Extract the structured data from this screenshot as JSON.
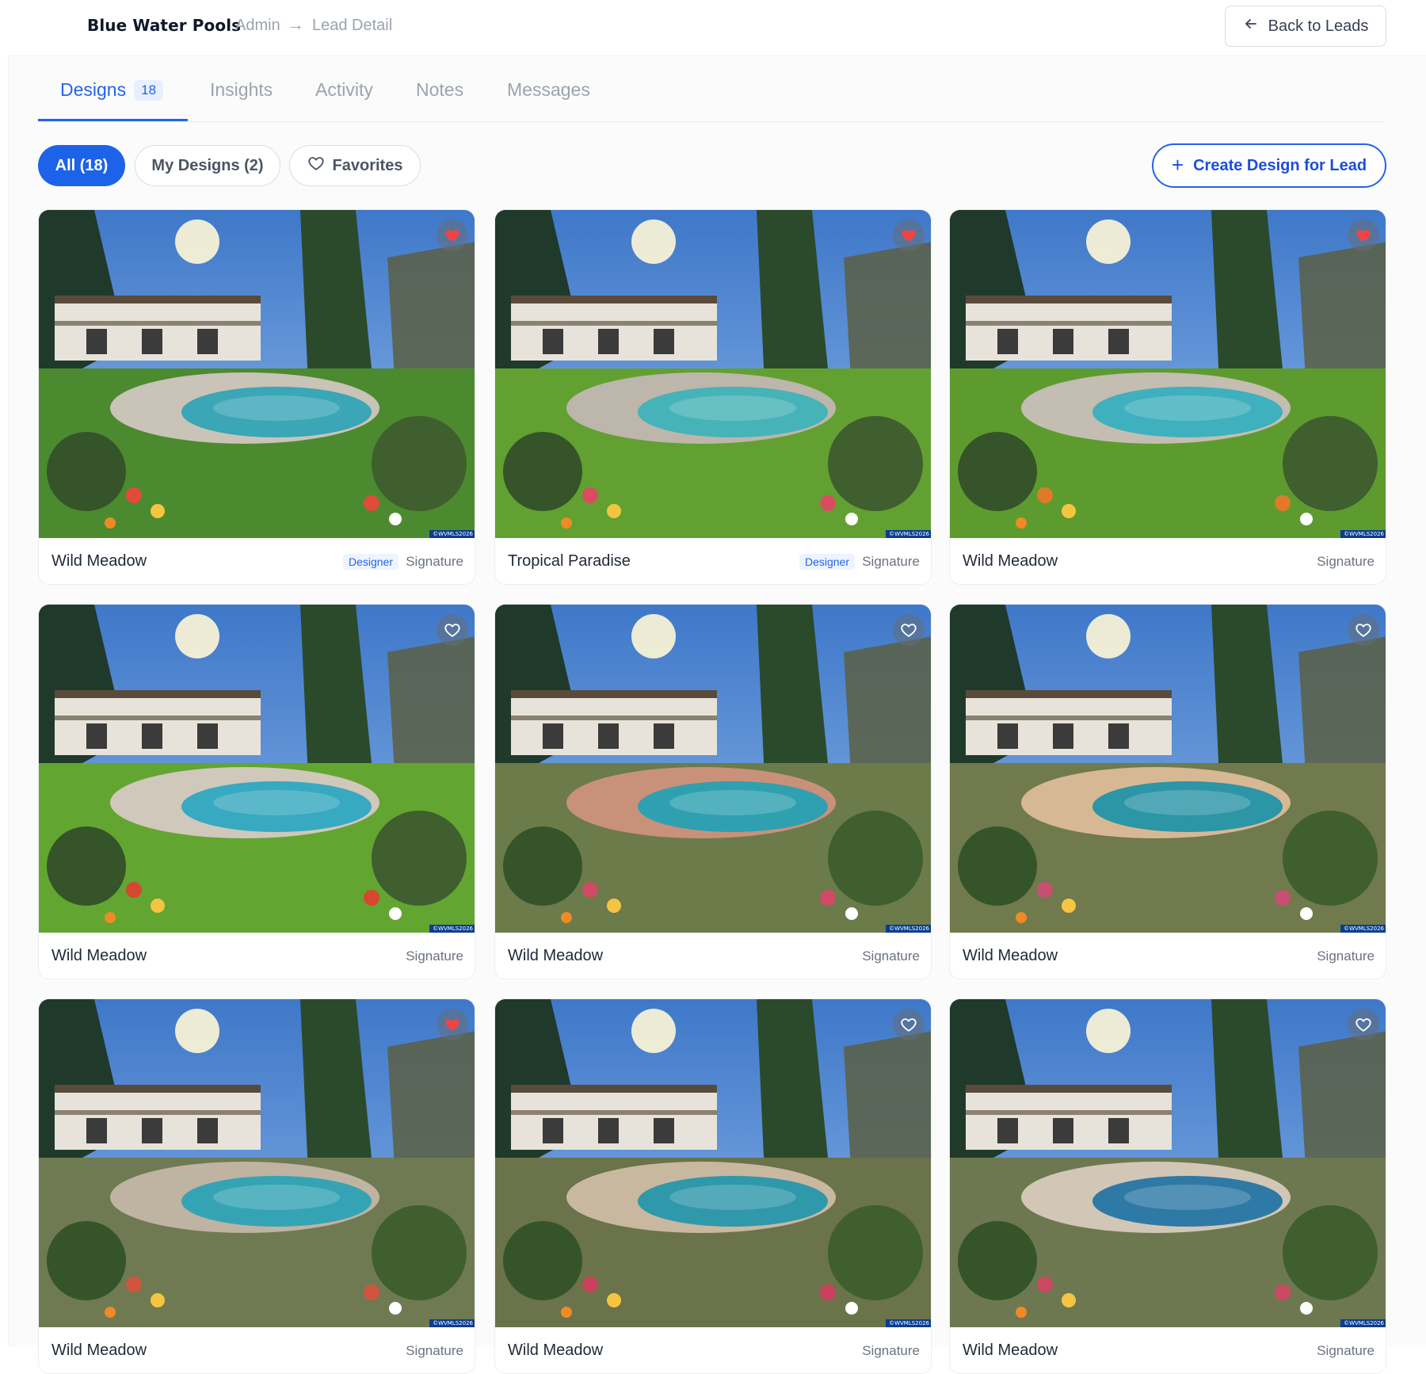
{
  "header": {
    "brand": "Blue Water Pools",
    "breadcrumb": [
      "Admin",
      "Lead Detail"
    ],
    "breadcrumb_separator": "→",
    "back_button_label": "Back to Leads",
    "back_icon": "arrow-left-icon"
  },
  "tabs": [
    {
      "label": "Designs",
      "count": "18",
      "active": true
    },
    {
      "label": "Insights",
      "active": false
    },
    {
      "label": "Activity",
      "active": false
    },
    {
      "label": "Notes",
      "active": false
    },
    {
      "label": "Messages",
      "active": false
    }
  ],
  "filters": {
    "all": "All (18)",
    "mine": "My Designs (2)",
    "favorites": "Favorites",
    "favorites_icon": "heart-outline-icon",
    "active": "all"
  },
  "create_button": {
    "label": "Create Design for Lead",
    "icon": "plus-icon"
  },
  "designs": [
    {
      "title": "Wild Meadow",
      "designer": "Designer",
      "tier": "Signature",
      "favorite": true,
      "watermark": "©WVMLS2026"
    },
    {
      "title": "Tropical Paradise",
      "designer": "Designer",
      "tier": "Signature",
      "favorite": true,
      "watermark": "©WVMLS2026"
    },
    {
      "title": "Wild Meadow",
      "designer": "",
      "tier": "Signature",
      "favorite": true,
      "watermark": "©WVMLS2026"
    },
    {
      "title": "Wild Meadow",
      "designer": "",
      "tier": "Signature",
      "favorite": false,
      "watermark": "©WVMLS2026"
    },
    {
      "title": "Wild Meadow",
      "designer": "",
      "tier": "Signature",
      "favorite": false,
      "watermark": "©WVMLS2026"
    },
    {
      "title": "Wild Meadow",
      "designer": "",
      "tier": "Signature",
      "favorite": false,
      "watermark": "©WVMLS2026"
    },
    {
      "title": "Wild Meadow",
      "designer": "",
      "tier": "Signature",
      "favorite": true,
      "watermark": "©WVMLS2026"
    },
    {
      "title": "Wild Meadow",
      "designer": "",
      "tier": "Signature",
      "favorite": false,
      "watermark": "©WVMLS2026"
    },
    {
      "title": "Wild Meadow",
      "designer": "",
      "tier": "Signature",
      "favorite": false,
      "watermark": "©WVMLS2026"
    }
  ],
  "colors": {
    "accent": "#2563eb",
    "favorite_active": "#ef4444",
    "muted_text": "#9ca3af"
  }
}
